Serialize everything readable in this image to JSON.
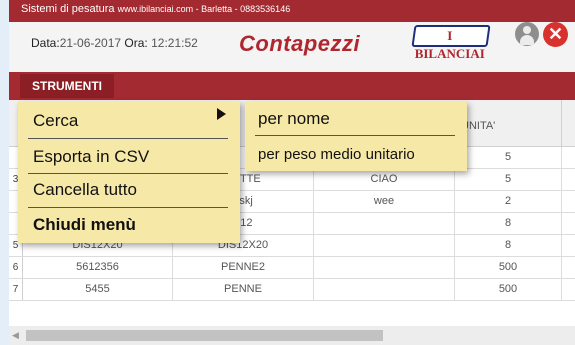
{
  "header": {
    "strip_title": "Sistemi di pesatura",
    "strip_url": "www.ibilanciai.com - Barletta - 0883536146",
    "date_label": "Data:",
    "date_value": "21-06-2017",
    "time_label": "Ora:",
    "time_value": "12:21:52",
    "app_title": "Contapezzi",
    "logo_text": "I BILANCIAI",
    "close_symbol": "✕"
  },
  "toolbar": {
    "strumenti_label": "STRUMENTI"
  },
  "table": {
    "header_unita": "UNITA'",
    "rows": [
      {
        "num": "",
        "c1": "",
        "c2": "",
        "c3": "",
        "c4": "5"
      },
      {
        "num": "3",
        "c1": "",
        "c2": "PETTE",
        "c3": "CIAO",
        "c4": "5"
      },
      {
        "num": "",
        "c1": "",
        "c2": "dskj",
        "c3": "wee",
        "c4": "2"
      },
      {
        "num": "",
        "c1": "",
        "c2": "I-12",
        "c3": "",
        "c4": "8"
      },
      {
        "num": "5",
        "c1": "DIS12X20",
        "c2": "DIS12X20",
        "c3": "",
        "c4": "8"
      },
      {
        "num": "6",
        "c1": "5612356",
        "c2": "PENNE2",
        "c3": "",
        "c4": "500"
      },
      {
        "num": "7",
        "c1": "5455",
        "c2": "PENNE",
        "c3": "",
        "c4": "500"
      }
    ]
  },
  "menu": {
    "items": [
      "Cerca",
      "Esporta in CSV",
      "Cancella tutto",
      "Chiudi menù"
    ]
  },
  "submenu": {
    "items": [
      "per nome",
      "per peso medio unitario"
    ]
  },
  "colors": {
    "brand_red": "#a32a30",
    "menu_bg": "#f6e9a7",
    "title_red": "#b0262e"
  }
}
